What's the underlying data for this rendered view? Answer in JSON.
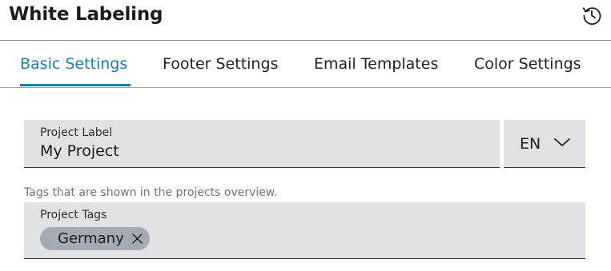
{
  "header": {
    "title": "White Labeling",
    "history_icon": "history-icon"
  },
  "tabs": [
    {
      "label": "Basic Settings",
      "active": true
    },
    {
      "label": "Footer Settings",
      "active": false
    },
    {
      "label": "Email Templates",
      "active": false
    },
    {
      "label": "Color Settings",
      "active": false
    }
  ],
  "project_label": {
    "label": "Project Label",
    "value": "My Project"
  },
  "language_select": {
    "value": "EN",
    "icon": "chevron-down-icon"
  },
  "project_tags": {
    "hint": "Tags that are shown in the projects overview.",
    "label": "Project Tags",
    "tags": [
      {
        "label": "Germany",
        "remove_icon": "close-icon"
      }
    ]
  },
  "colors": {
    "accent": "#1a7fb0",
    "field_bg": "#e0e2e5",
    "chip_bg": "#a4abb3"
  }
}
